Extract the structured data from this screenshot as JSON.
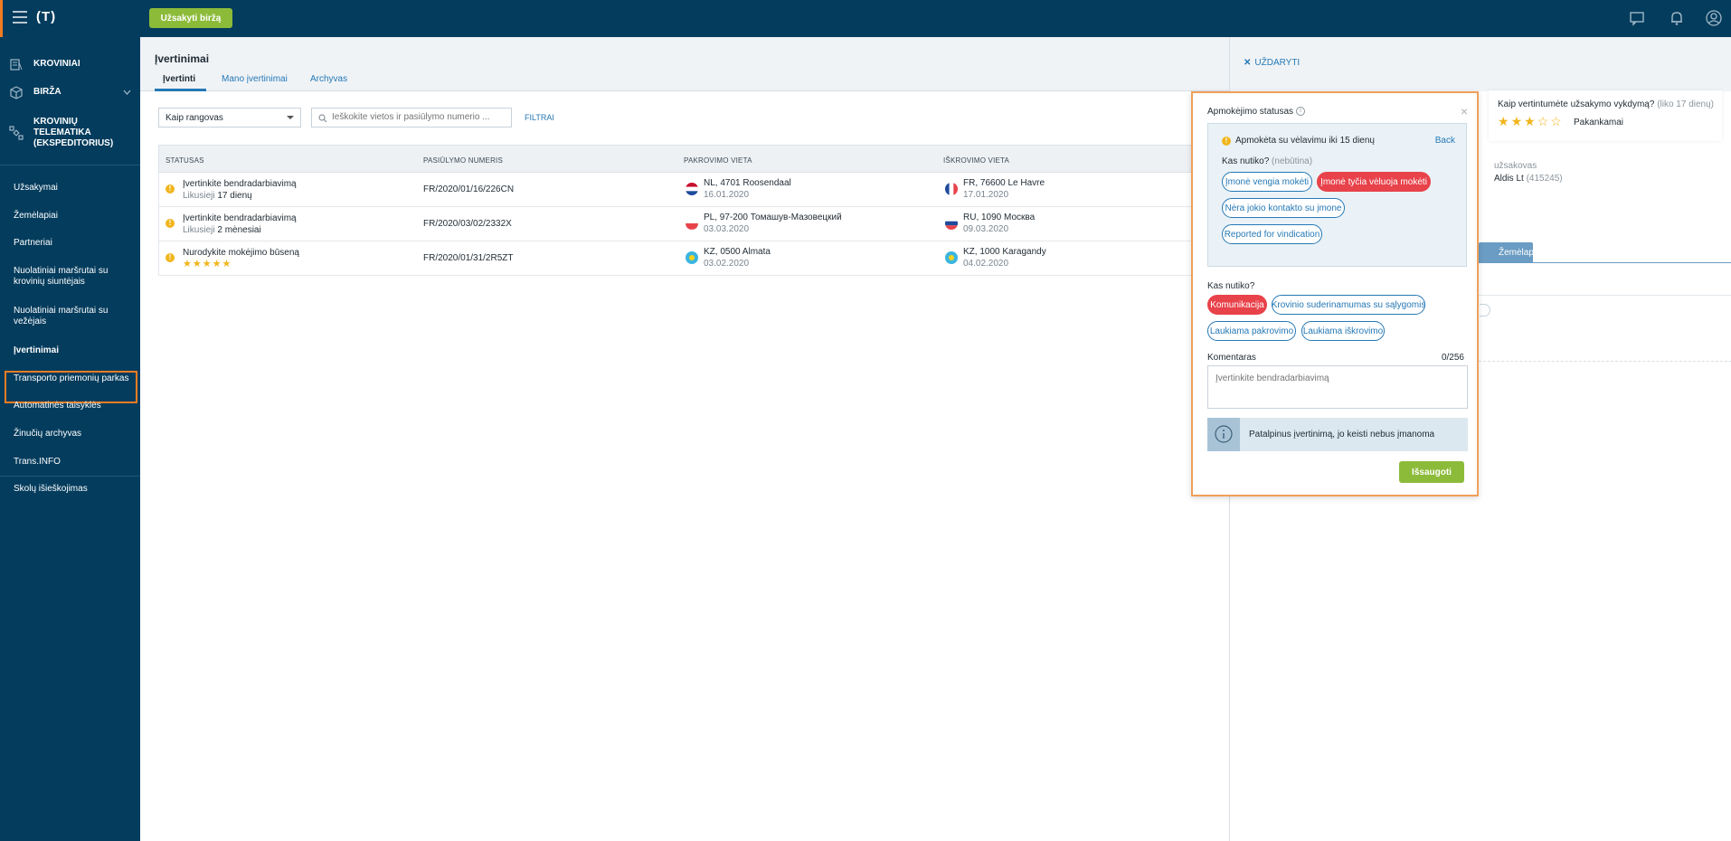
{
  "topbar": {
    "logo": "(T)",
    "order_button": "Užsakyti biržą",
    "icons": [
      "menu-icon",
      "messages-icon",
      "bell-icon",
      "user-icon"
    ]
  },
  "sidebar": {
    "sections": [
      {
        "label": "KROVINIAI",
        "icon": "cargo-icon"
      },
      {
        "label": "BIRŽA",
        "icon": "exchange-icon"
      },
      {
        "label": "KROVINIŲ TELEMATIKA (EKSPEDITORIUS)",
        "icon": "satellite-icon"
      }
    ],
    "items": [
      "Užsakymai",
      "Žemėlapiai",
      "Partneriai",
      "Nuolatiniai maršrutai su krovinių siuntėjais",
      "Nuolatiniai maršrutai su vežėjais",
      "Įvertinimai",
      "Transporto priemonių parkas",
      "Automatinės taisyklės",
      "Žinučių archyvas",
      "Trans.INFO",
      "Skolų išieškojimas"
    ]
  },
  "main": {
    "title": "Įvertinimai",
    "tabs": [
      "Įvertinti",
      "Mano įvertinimai",
      "Archyvas"
    ],
    "filter_select": "Kaip rangovas",
    "search_placeholder": "Ieškokite vietos ir pasiūlymo numerio ...",
    "filters_link": "FILTRAI",
    "columns": [
      "STATUSAS",
      "PASIŪLYMO NUMERIS",
      "PAKROVIMO VIETA",
      "IŠKROVIMO VIETA"
    ],
    "rows": [
      {
        "status": "Įvertinkite bendradarbiavimą",
        "remaining_label": "Likusieji",
        "remaining_value": "17 dienų",
        "number": "FR/2020/01/16/226CN",
        "load_place": "NL, 4701 Roosendaal",
        "load_date": "16.01.2020",
        "unload_place": "FR, 76600 Le Havre",
        "unload_date": "17.01.2020"
      },
      {
        "status": "Įvertinkite bendradarbiavimą",
        "remaining_label": "Likusieji",
        "remaining_value": "2 mėnesiai",
        "number": "FR/2020/03/02/2332X",
        "load_place": "PL, 97-200 Томашув-Мазовецкий",
        "load_date": "03.03.2020",
        "unload_place": "RU, 1090 Москва",
        "unload_date": "09.03.2020"
      },
      {
        "status": "Nurodykite mokėjimo būseną",
        "stars": "★★★★★",
        "number": "FR/2020/01/31/2R5ZT",
        "load_place": "KZ, 0500 Almata",
        "load_date": "03.02.2020",
        "unload_place": "KZ, 1000 Karagandy",
        "unload_date": "04.02.2020"
      }
    ]
  },
  "right_panel": {
    "close_label": "UŽDARYTI",
    "rating_question": "Kaip vertintumėte užsakymo vykdymą?",
    "rating_hint": "(liko 17 dienų)",
    "rating_stars": 3,
    "rating_label": "Pakankamai",
    "client_label": "užsakovas",
    "client_name": "Aldis Lt",
    "client_id": "(415245)",
    "map_tab": "Žemėlapis"
  },
  "popup": {
    "title": "Apmokėjimo statusas",
    "payment_status": "Apmokėta su vėlavimu iki 15 dienų",
    "back_link": "Back",
    "question1": "Kas nutiko?",
    "question1_hint": "(nebūtina)",
    "reasons1": [
      {
        "label": "Įmonė vengia mokėti",
        "selected": false
      },
      {
        "label": "Įmonė tyčia vėluoja mokėti",
        "selected": true
      },
      {
        "label": "Nėra jokio kontakto su įmone",
        "selected": false
      },
      {
        "label": "Reported for vindication",
        "selected": false
      }
    ],
    "question2": "Kas nutiko?",
    "reasons2": [
      {
        "label": "Komunikacija",
        "selected": true
      },
      {
        "label": "Krovinio suderinamumas su sąlygomis",
        "selected": false
      },
      {
        "label": "Laukiama pakrovimo",
        "selected": false
      },
      {
        "label": "Laukiama iškrovimo",
        "selected": false
      }
    ],
    "comment_label": "Komentaras",
    "comment_count": "0/256",
    "comment_placeholder": "Įvertinkite bendradarbiavimą",
    "info_note": "Patalpinus įvertinimą, jo keisti nebus įmanoma",
    "save_button": "Išsaugoti"
  },
  "colors": {
    "navy": "#043c5d",
    "accent_orange": "#f27c21",
    "green": "#8cbb3a",
    "blue_link": "#2578b5",
    "red_chip": "#e8424a",
    "star": "#f1b51c"
  }
}
